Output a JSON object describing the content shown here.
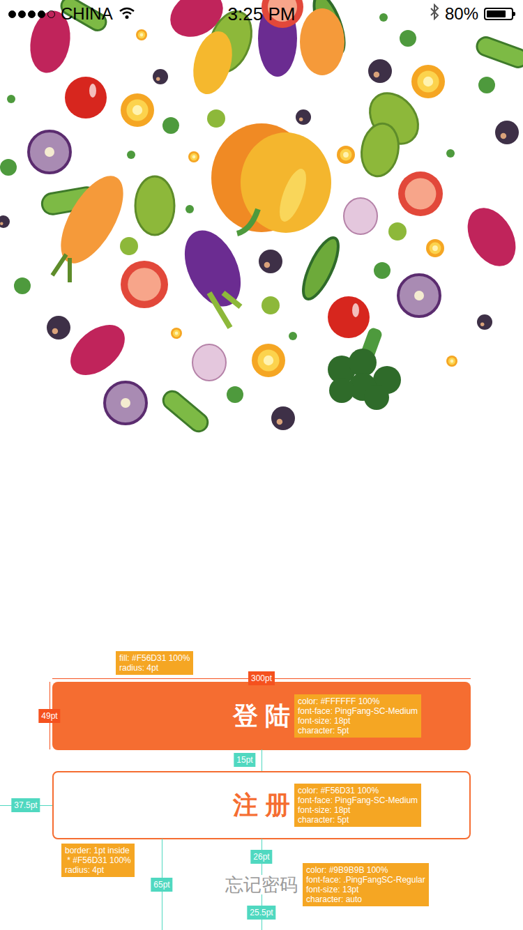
{
  "status_bar": {
    "carrier": "CHINA",
    "time": "3:25 PM",
    "battery": "80%",
    "battery_level": 0.8,
    "signal_level": 0.8
  },
  "buttons": [
    {
      "label": "登陆",
      "kind": "filled"
    },
    {
      "label": "注册",
      "kind": "outline"
    }
  ],
  "forgot_password": "忘记密码",
  "dimensions": [
    {
      "label": "300pt",
      "color": "#F5511E"
    },
    {
      "label": "49pt",
      "color": "#F5511E"
    },
    {
      "label": "15pt",
      "color": "#50D8C0"
    },
    {
      "label": "37.5pt",
      "color": "#50D8C0"
    },
    {
      "label": "26pt",
      "color": "#50D8C0"
    },
    {
      "label": "65pt",
      "color": "#50D8C0"
    },
    {
      "label": "25.5pt",
      "color": "#50D8C0"
    }
  ],
  "annotations": [
    {
      "lines": [
        "fill: #F56D31 100%",
        "radius: 4pt"
      ]
    },
    {
      "lines": [
        "color: #FFFFFF 100%",
        "font-face: PingFang-SC-Medium",
        "font-size: 18pt",
        "character: 5pt"
      ]
    },
    {
      "lines": [
        "color: #F56D31 100%",
        "font-face: PingFang-SC-Medium",
        "font-size: 18pt",
        "character: 5pt"
      ]
    },
    {
      "lines": [
        "border: 1pt inside",
        " * #F56D31 100%",
        "radius: 4pt"
      ]
    },
    {
      "lines": [
        "color: #9B9B9B 100%",
        "font-face: .PingFangSC-Regular",
        "font-size: 13pt",
        "character: auto"
      ]
    }
  ]
}
